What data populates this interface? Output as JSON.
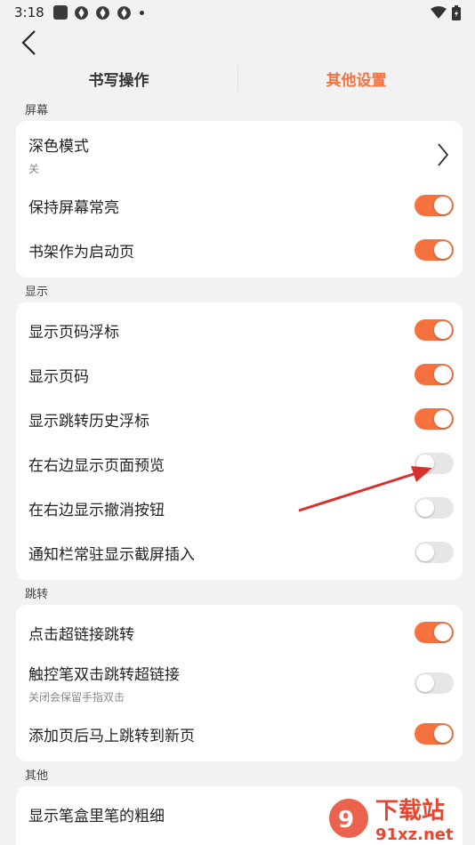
{
  "status_bar": {
    "time": "3:18"
  },
  "tabs": [
    {
      "label": "书写操作",
      "active": false
    },
    {
      "label": "其他设置",
      "active": true
    }
  ],
  "sections": {
    "screen": {
      "label": "屏幕",
      "items": [
        {
          "title": "深色模式",
          "subtitle": "关",
          "control": "chevron"
        },
        {
          "title": "保持屏幕常亮",
          "on": true
        },
        {
          "title": "书架作为启动页",
          "on": true
        }
      ]
    },
    "display": {
      "label": "显示",
      "items": [
        {
          "title": "显示页码浮标",
          "on": true
        },
        {
          "title": "显示页码",
          "on": true
        },
        {
          "title": "显示跳转历史浮标",
          "on": true
        },
        {
          "title": "在右边显示页面预览",
          "on": false
        },
        {
          "title": "在右边显示撤消按钮",
          "on": false
        },
        {
          "title": "通知栏常驻显示截屏插入",
          "on": false
        }
      ]
    },
    "jump": {
      "label": "跳转",
      "items": [
        {
          "title": "点击超链接跳转",
          "on": true
        },
        {
          "title": "触控笔双击跳转超链接",
          "subtitle": "关闭会保留手指双击",
          "on": false
        },
        {
          "title": "添加页后马上跳转到新页",
          "on": true
        }
      ]
    },
    "other": {
      "label": "其他",
      "items": [
        {
          "title": "显示笔盒里笔的粗细"
        }
      ]
    }
  },
  "watermark": {
    "text": "下载站",
    "url_text": "91xz.net"
  },
  "colors": {
    "accent": "#f5713d",
    "toggle_off": "#e6e6e6",
    "arrow": "#d9302b"
  }
}
